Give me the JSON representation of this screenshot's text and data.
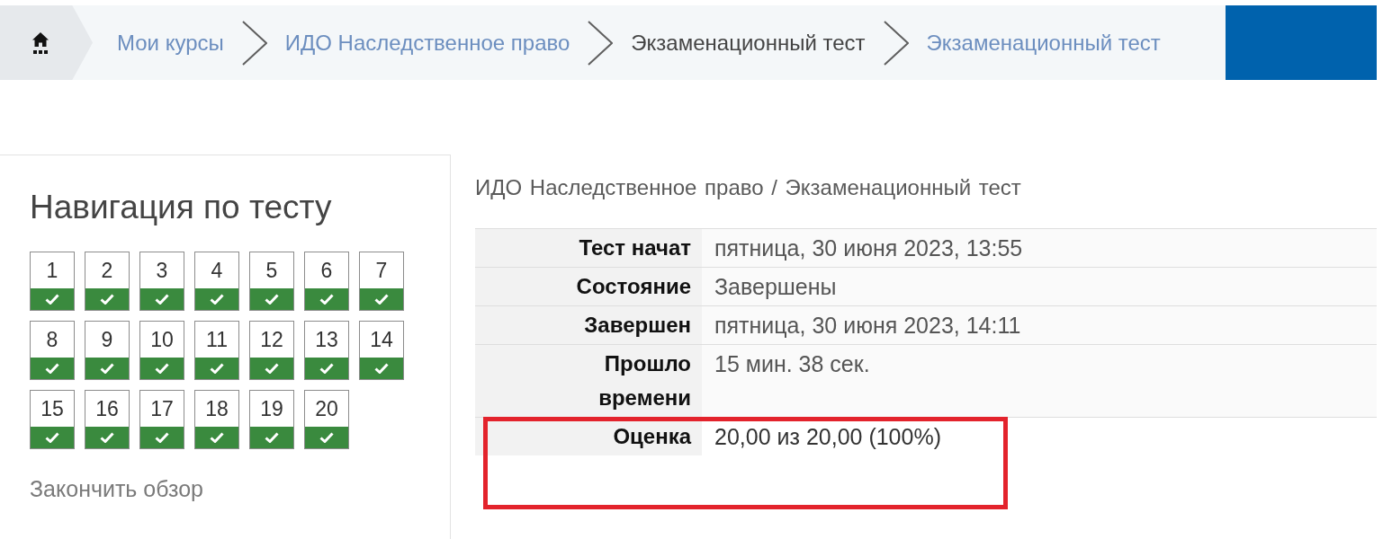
{
  "breadcrumb": {
    "items": [
      {
        "label": "Мои курсы",
        "link": true
      },
      {
        "label": "ИДО Наследственное право",
        "link": true
      },
      {
        "label": "Экзаменационный тест",
        "link": false
      },
      {
        "label": "Экзаменационный тест",
        "link": true
      }
    ]
  },
  "quiz_navigation": {
    "title": "Навигация по тесту",
    "questions": [
      {
        "number": "1",
        "answered": true
      },
      {
        "number": "2",
        "answered": true
      },
      {
        "number": "3",
        "answered": true
      },
      {
        "number": "4",
        "answered": true
      },
      {
        "number": "5",
        "answered": true
      },
      {
        "number": "6",
        "answered": true
      },
      {
        "number": "7",
        "answered": true
      },
      {
        "number": "8",
        "answered": true
      },
      {
        "number": "9",
        "answered": true
      },
      {
        "number": "10",
        "answered": true
      },
      {
        "number": "11",
        "answered": true
      },
      {
        "number": "12",
        "answered": true
      },
      {
        "number": "13",
        "answered": true
      },
      {
        "number": "14",
        "answered": true
      },
      {
        "number": "15",
        "answered": true
      },
      {
        "number": "16",
        "answered": true
      },
      {
        "number": "17",
        "answered": true
      },
      {
        "number": "18",
        "answered": true
      },
      {
        "number": "19",
        "answered": true
      },
      {
        "number": "20",
        "answered": true
      }
    ],
    "finish_link": "Закончить обзор"
  },
  "summary": {
    "path": "ИДО Наследственное право / Экзаменационный тест",
    "rows": [
      {
        "label": "Тест начат",
        "value": "пятница, 30 июня 2023, 13:55",
        "highlighted": false
      },
      {
        "label": "Состояние",
        "value": "Завершены",
        "highlighted": false
      },
      {
        "label": "Завершен",
        "value": "пятница, 30 июня 2023, 14:11",
        "highlighted": false
      },
      {
        "label": "Прошло времени",
        "value": "15 мин. 38 сек.",
        "highlighted": false
      },
      {
        "label": "Оценка",
        "value": "20,00 из 20,00 (100%)",
        "highlighted": true
      }
    ]
  }
}
